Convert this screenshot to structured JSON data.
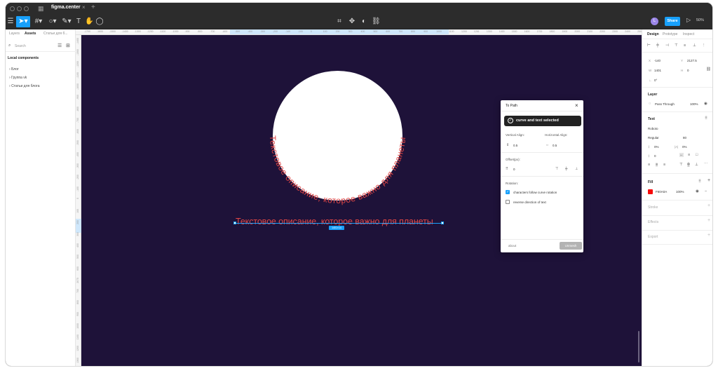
{
  "titlebar": {
    "tab_title": "figma.center"
  },
  "toolbar": {
    "avatar_letter": "L",
    "share_label": "Share",
    "zoom_label": "50%"
  },
  "left_panel": {
    "tabs": [
      "Layers",
      "Assets",
      "Статьи для б..."
    ],
    "search_placeholder": "Search",
    "heading": "Local components",
    "items": [
      "Блог",
      "Группа vk",
      "Статьи для блога"
    ]
  },
  "canvas": {
    "curved_text": "Текстовое описание, которое важно для планеты",
    "line_text": "Текстовое описание, которое важно для планеты",
    "size_badge": "1401×14",
    "h_ruler": [
      "-1700",
      "-1600",
      "-1500",
      "-1400",
      "-1300",
      "-1200",
      "-1100",
      "-1000",
      "-900",
      "-800",
      "-700",
      "-600",
      "-500",
      "-400",
      "-300",
      "-200",
      "-140",
      "-100",
      "0",
      "100",
      "200",
      "300",
      "400",
      "500",
      "600",
      "700",
      "800",
      "900",
      "1000",
      "1100",
      "1200",
      "1261",
      "1300",
      "1400",
      "1500",
      "1600",
      "1700",
      "1800",
      "1900",
      "2000",
      "2100",
      "2200",
      "2300",
      "2400",
      "2500"
    ],
    "v_ruler": [
      "-1400",
      "-1300",
      "-1200",
      "-1100",
      "-1000",
      "-900",
      "-800",
      "-700",
      "-600",
      "-500",
      "-400",
      "-300",
      "-200",
      "-100",
      "0",
      "100",
      "200",
      "300",
      "400",
      "500",
      "600",
      "2075",
      "700",
      "800",
      "900",
      "1000",
      "1100",
      "1200",
      "1300"
    ]
  },
  "plugin": {
    "title": "To Path",
    "toast": "curve and text selected",
    "vertical_align_label": "Vertical Align:",
    "vertical_align_value": "0.5",
    "horizontal_align_label": "Horizontal Align:",
    "horizontal_align_value": "0.5",
    "offset_label": "Offset(px):",
    "offset_value": "0",
    "rotation_label": "Rotation:",
    "follow_curve_label": "characters follow curve rotation",
    "follow_curve_checked": true,
    "reverse_label": "reverse direction of text",
    "reverse_checked": false,
    "about_label": "about",
    "unmesh_label": "Unmesh"
  },
  "right_panel": {
    "tabs": [
      "Design",
      "Prototype",
      "Inspect"
    ],
    "x_label": "X",
    "x_value": "-140",
    "y_label": "Y",
    "y_value": "2127.5",
    "w_label": "W",
    "w_value": "1401",
    "h_label": "H",
    "h_value": "0",
    "rotation_value": "0°",
    "layer_heading": "Layer",
    "blend_mode": "Pass Through",
    "layer_opacity": "100%",
    "text_heading": "Text",
    "font_family": "Roboto",
    "font_weight": "Regular",
    "font_size": "80",
    "line_height": "0%",
    "letter_spacing": "0%",
    "paragraph_spacing": "0",
    "fill_heading": "Fill",
    "fill_hex": "F60A0A",
    "fill_color": "#F60A0A",
    "fill_opacity": "100%",
    "stroke_heading": "Stroke",
    "effects_heading": "Effects",
    "export_heading": "Export"
  }
}
